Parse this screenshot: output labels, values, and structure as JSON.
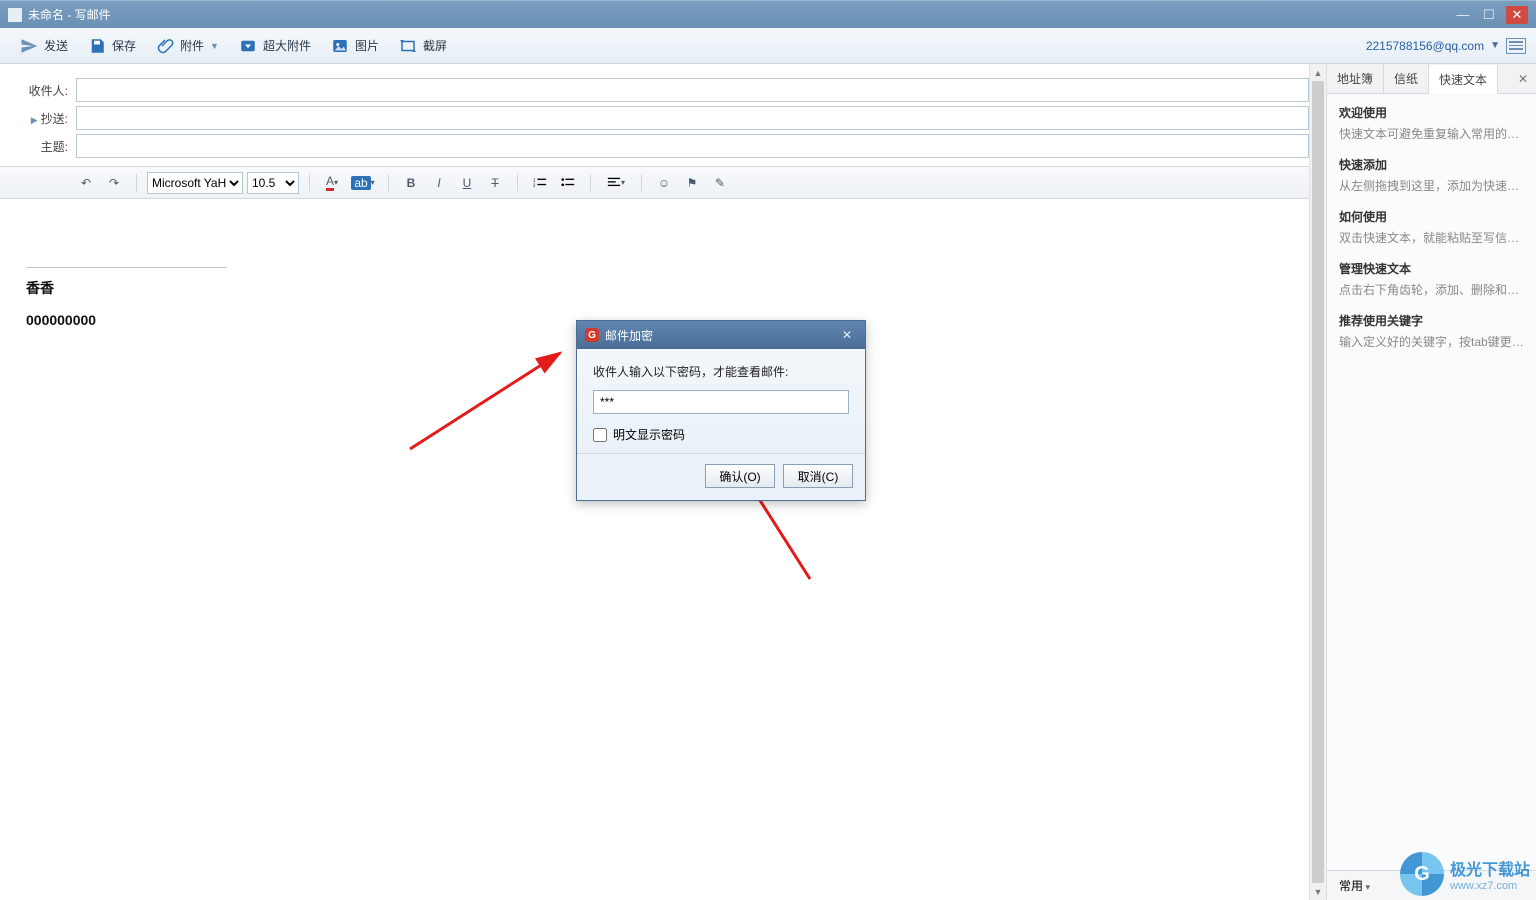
{
  "window": {
    "title": "未命名 - 写邮件"
  },
  "toolbar": {
    "send": "发送",
    "save": "保存",
    "attach": "附件",
    "big_attach": "超大附件",
    "image": "图片",
    "screenshot": "截屏",
    "account": "2215788156@qq.com"
  },
  "compose": {
    "to_label": "收件人:",
    "cc_label": "抄送:",
    "subject_label": "主题:",
    "to_value": "",
    "cc_value": "",
    "subject_value": ""
  },
  "editor": {
    "font": "Microsoft YaH",
    "size": "10.5",
    "sig_name": "香香",
    "sig_number": "000000000"
  },
  "dialog": {
    "title": "邮件加密",
    "prompt": "收件人输入以下密码，才能查看邮件:",
    "password_value": "***",
    "show_plain": "明文显示密码",
    "ok": "确认(O)",
    "cancel": "取消(C)"
  },
  "right": {
    "tab1": "地址簿",
    "tab2": "信纸",
    "tab3": "快速文本",
    "items": [
      {
        "t": "欢迎使用",
        "d": "快速文本可避免重复输入常用的内..."
      },
      {
        "t": "快速添加",
        "d": "从左侧拖拽到这里，添加为快速文..."
      },
      {
        "t": "如何使用",
        "d": "双击快速文本，就能粘贴至写信区..."
      },
      {
        "t": "管理快速文本",
        "d": "点击右下角齿轮，添加、删除和管..."
      },
      {
        "t": "推荐使用关键字",
        "d": "输入定义好的关键字，按tab键更快..."
      }
    ],
    "footer": "常用"
  },
  "watermark": {
    "cn": "极光下载站",
    "url": "www.xz7.com"
  }
}
